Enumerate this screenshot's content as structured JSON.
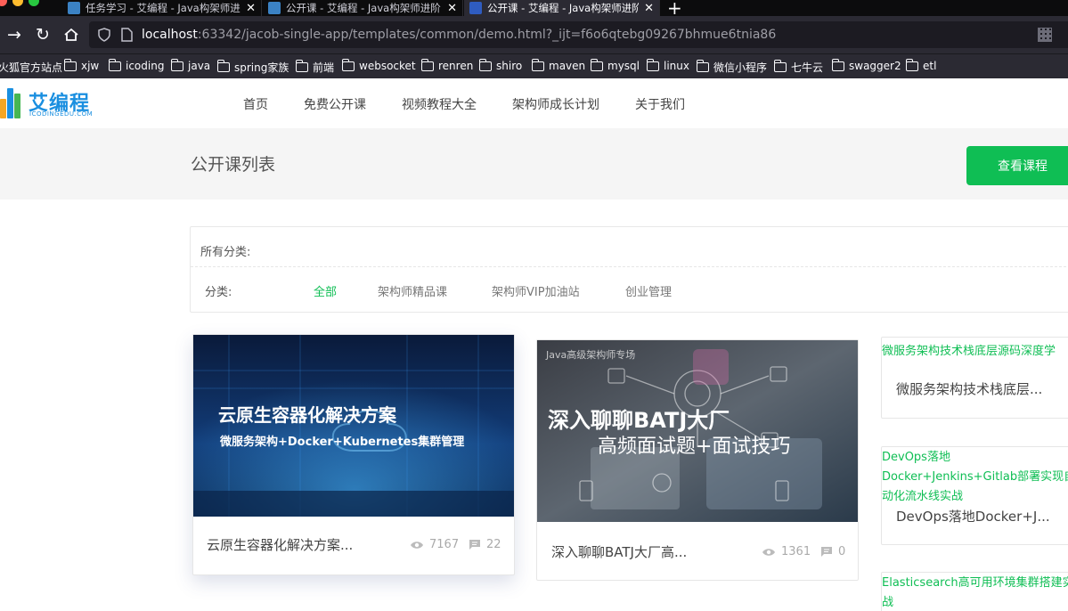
{
  "browser": {
    "tabs": [
      {
        "title": "任务学习 - 艾编程 - Java构架师进阶"
      },
      {
        "title": "公开课 - 艾编程 - Java构架师进阶"
      },
      {
        "title": "公开课 - 艾编程 - Java构架师进阶"
      }
    ],
    "url_host": "localhost",
    "url_rest": ":63342/jacob-single-app/templates/common/demo.html?_ijt=f6o6qtebg09267bhmue6tnia86",
    "bookmarks": [
      "火狐官方站点",
      "xjw",
      "icoding",
      "java",
      "spring家族",
      "前端",
      "websocket",
      "renren",
      "shiro",
      "maven",
      "mysql",
      "linux",
      "微信小程序",
      "七牛云",
      "swagger2",
      "etl"
    ]
  },
  "site": {
    "logo_text": "艾编程",
    "logo_sub": "ICODINGEDU.COM",
    "nav": [
      "首页",
      "免费公开课",
      "视频教程大全",
      "架构师成长计划",
      "关于我们"
    ],
    "page_title": "公开课列表",
    "view_button": "查看课程",
    "accent": "#0fbe54"
  },
  "filter": {
    "all_label": "所有分类:",
    "category_label": "分类:",
    "options": [
      "全部",
      "架构师精品课",
      "架构师VIP加油站",
      "创业管理"
    ],
    "active_index": 0
  },
  "courses": [
    {
      "thumb_line1": "云原生容器化解决方案",
      "thumb_line2": "微服务架构+Docker+Kubernetes集群管理",
      "title": "云原生容器化解决方案...",
      "views": "7167",
      "comments": "22"
    },
    {
      "thumb_tag": "Java高级架构师专场",
      "thumb_line1": "深入聊聊BATJ大厂",
      "thumb_line2": "高频面试题+面试技巧",
      "title": "深入聊聊BATJ大厂高...",
      "views": "1361",
      "comments": "0"
    }
  ],
  "side_courses": [
    {
      "link": "微服务架构技术栈底层源码深度学",
      "text": "微服务架构技术栈底层..."
    },
    {
      "link": "DevOps落地Docker+Jenkins+Gitlab部署实现自动化流水线实战",
      "text": "DevOps落地Docker+J..."
    },
    {
      "link": "Elasticsearch高可用环境集群搭建实战",
      "text": ""
    }
  ]
}
